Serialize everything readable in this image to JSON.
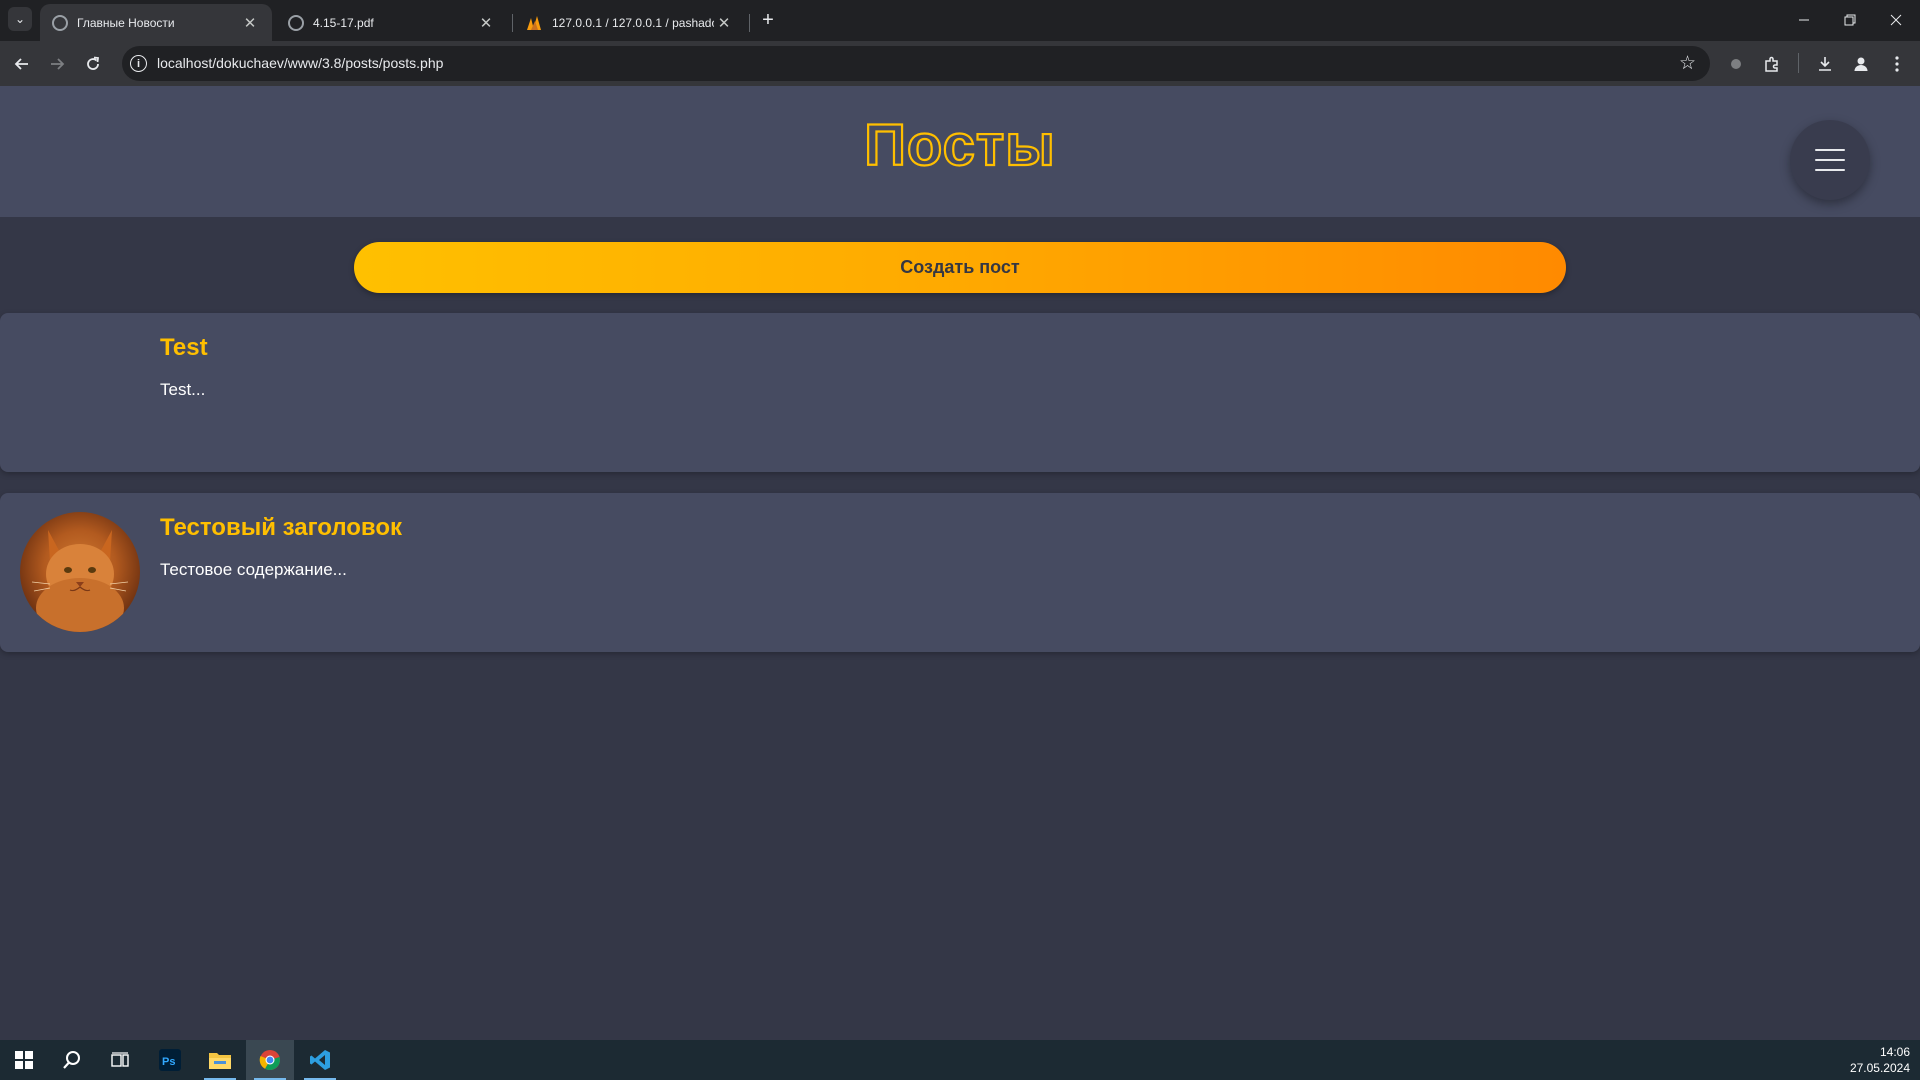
{
  "browser": {
    "tabs": [
      {
        "title": "Главные Новости",
        "active": true
      },
      {
        "title": "4.15-17.pdf",
        "active": false
      },
      {
        "title": "127.0.0.1 / 127.0.0.1 / pashadok",
        "active": false
      }
    ],
    "url": "localhost/dokuchaev/www/3.8/posts/posts.php"
  },
  "site": {
    "title": "Посты",
    "create_button": "Создать пост",
    "posts": [
      {
        "title": "Test",
        "excerpt": "Test...",
        "has_image": false
      },
      {
        "title": "Тестовый заголовок",
        "excerpt": "Тестовое содержание...",
        "has_image": true
      }
    ]
  },
  "taskbar": {
    "time": "14:06",
    "date": "27.05.2024",
    "apps": [
      "start-icon",
      "search-icon",
      "task-view-icon",
      "photoshop-icon",
      "file-explorer-icon",
      "chrome-icon",
      "vscode-icon"
    ]
  },
  "colors": {
    "accent": "#ffbf00",
    "page_bg": "#343747",
    "card_bg": "#464b61"
  }
}
